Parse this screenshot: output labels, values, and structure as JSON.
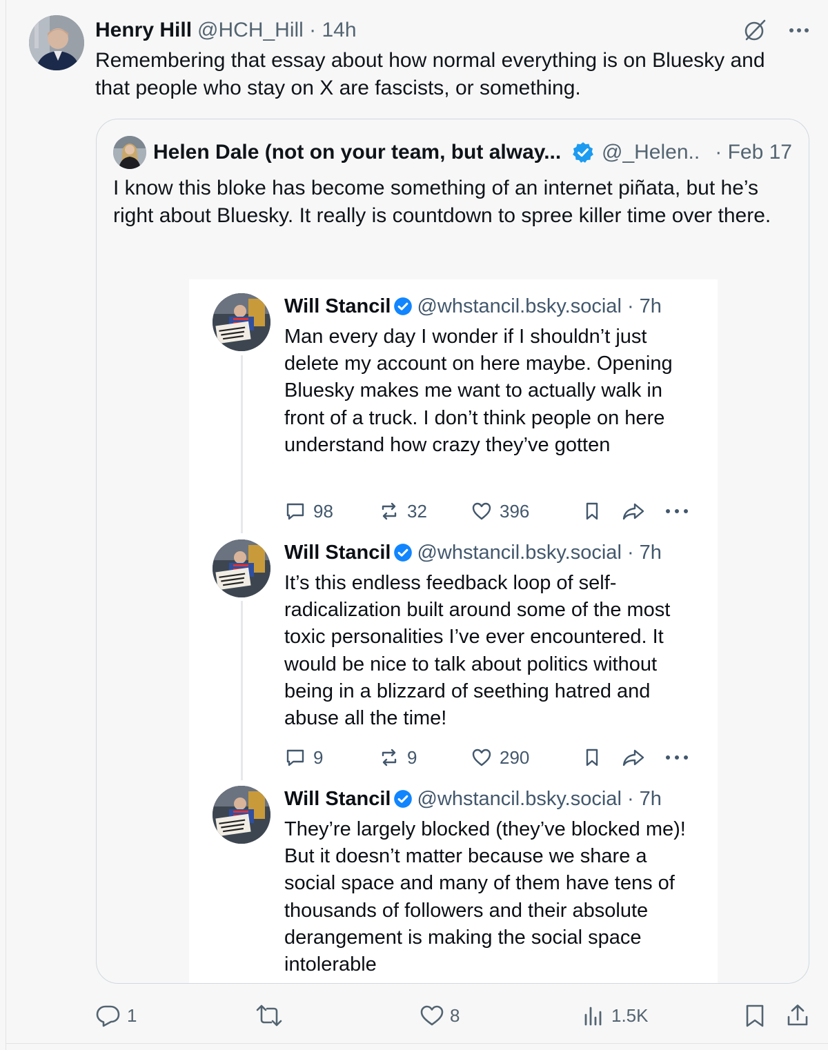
{
  "tweet": {
    "author_name": "Henry Hill",
    "meta": "@HCH_Hill · 14h",
    "text": "Remembering that essay about how normal everything is on Bluesky and that people who stay on X are fascists, or something.",
    "icons": [
      "grok-icon",
      "more-icon"
    ],
    "actions": {
      "reply_count": "1",
      "like_count": "8",
      "views_count": "1.5K"
    }
  },
  "quote": {
    "author_name": "Helen Dale (not on your team, but alway...",
    "handle": "@_Helen...",
    "date": "· Feb 17",
    "text": "I know this bloke has become something of an internet piñata, but he’s right about Bluesky. It really is countdown to spree killer time over there.",
    "verified_color": "#1d9bf0"
  },
  "embedded_posts": [
    {
      "name": "Will Stancil",
      "handle": "@whstancil.bsky.social · 7h",
      "text": "Man every day I wonder if I shouldn’t just delete my account on here maybe. Opening Bluesky makes me want to actually walk in front of a truck. I don’t think people on here understand how crazy they’ve gotten",
      "replies": "98",
      "reposts": "32",
      "likes": "396",
      "avatar_sign": "There are more of us than them"
    },
    {
      "name": "Will Stancil",
      "handle": "@whstancil.bsky.social · 7h",
      "text": "It’s this endless feedback loop of self-radicalization built around some of the most toxic personalities I’ve ever encountered. It would be nice to talk about politics without being in a blizzard of seething hatred and abuse all the time!",
      "replies": "9",
      "reposts": "9",
      "likes": "290",
      "avatar_sign": "There are more of us than them"
    },
    {
      "name": "Will Stancil",
      "handle": "@whstancil.bsky.social · 7h",
      "text": "They’re largely blocked (they’ve blocked me)! But it doesn’t matter because we share a social space and many of them have tens of thousands of followers and their absolute derangement is making the social space intolerable",
      "avatar_sign": "There are more of us than them"
    }
  ],
  "colors": {
    "background": "#f7f7f7",
    "text": "#0f1419",
    "muted": "#536471",
    "bluesky_verified": "#1185fe"
  }
}
